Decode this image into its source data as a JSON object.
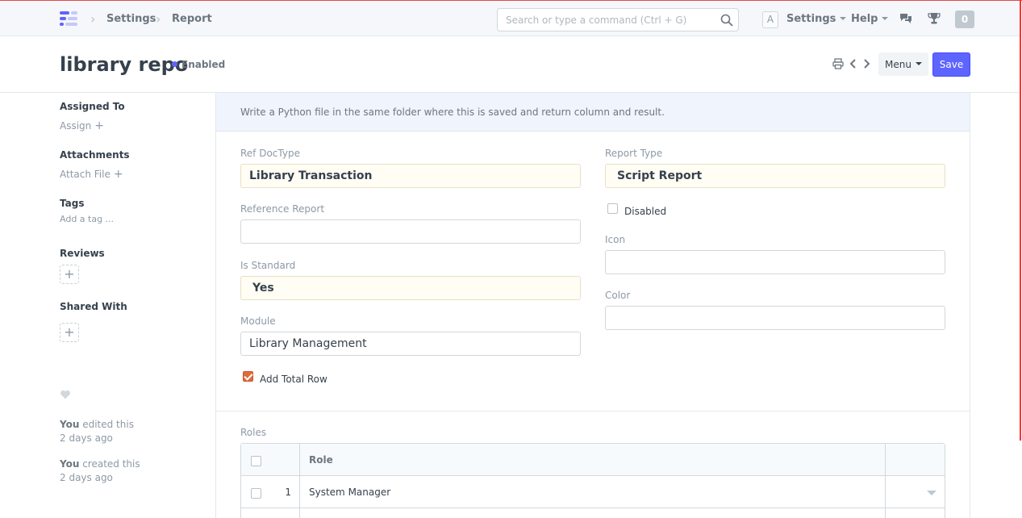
{
  "navbar": {
    "breadcrumbs": [
      "Settings",
      "Report"
    ],
    "search_placeholder": "Search or type a command (Ctrl + G)",
    "avatar_letter": "A",
    "settings_label": "Settings",
    "help_label": "Help",
    "notification_count": "0",
    "colors": {
      "logo_primary": "#5e64ff",
      "logo_secondary": "#c4c8fb"
    }
  },
  "page": {
    "title": "library repo",
    "status": "Enabled",
    "status_color": "#5e64ff",
    "menu_label": "Menu",
    "save_label": "Save"
  },
  "sidebar": {
    "assigned_to_label": "Assigned To",
    "assign_link": "Assign",
    "attachments_label": "Attachments",
    "attach_link": "Attach File",
    "tags_label": "Tags",
    "add_tag_link": "Add a tag ...",
    "reviews_label": "Reviews",
    "shared_with_label": "Shared With",
    "timeline": [
      {
        "user": "You",
        "action": "edited this",
        "when": "2 days ago"
      },
      {
        "user": "You",
        "action": "created this",
        "when": "2 days ago"
      }
    ]
  },
  "form": {
    "help_text": "Write a Python file in the same folder where this is saved and return column and result.",
    "ref_doctype": {
      "label": "Ref DocType",
      "value": "Library Transaction"
    },
    "reference_report": {
      "label": "Reference Report",
      "value": ""
    },
    "is_standard": {
      "label": "Is Standard",
      "value": "Yes"
    },
    "module": {
      "label": "Module",
      "value": "Library Management"
    },
    "add_total_row": {
      "label": "Add Total Row",
      "checked": true
    },
    "report_type": {
      "label": "Report Type",
      "value": "Script Report"
    },
    "disabled": {
      "label": "Disabled",
      "checked": false
    },
    "icon": {
      "label": "Icon",
      "value": ""
    },
    "color": {
      "label": "Color",
      "value": ""
    },
    "roles": {
      "label": "Roles",
      "column_header": "Role",
      "rows": [
        {
          "idx": "1",
          "role": "System Manager"
        }
      ]
    }
  }
}
